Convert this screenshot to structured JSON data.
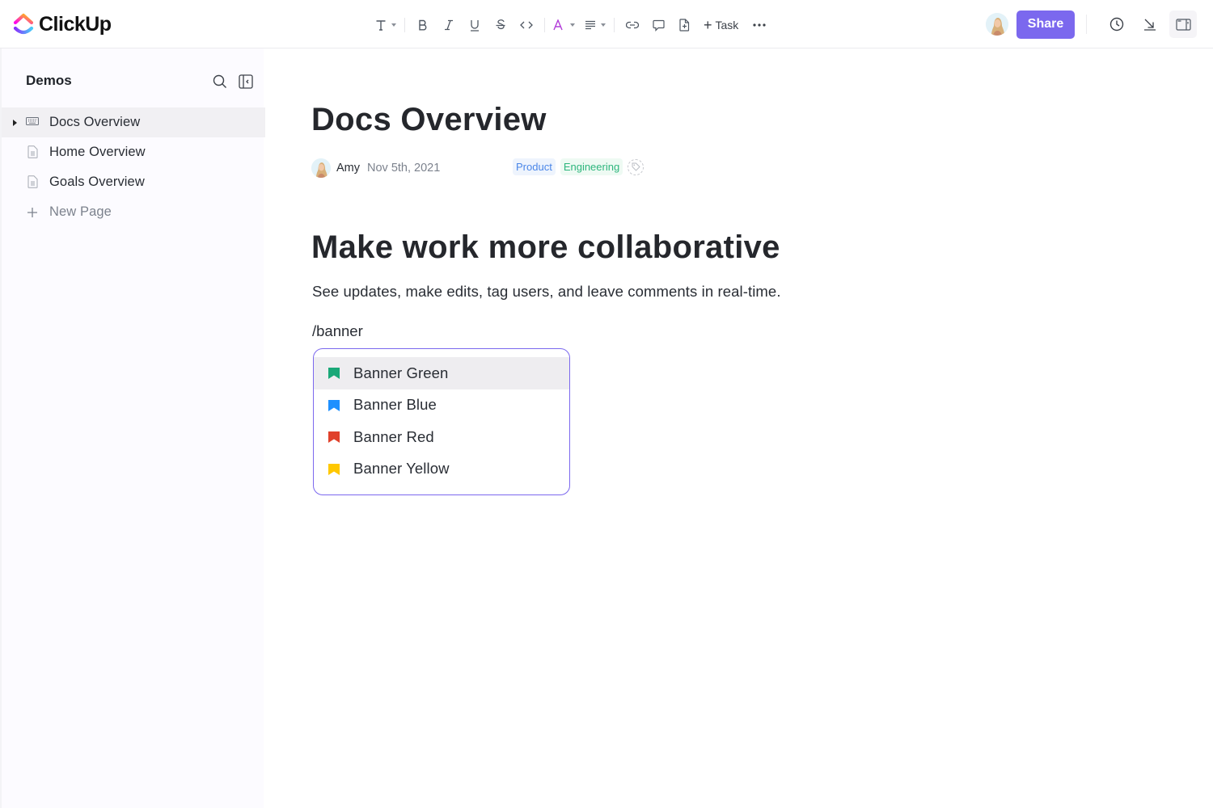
{
  "app": {
    "name": "ClickUp",
    "brand_color": "#7b68ee"
  },
  "toolbar": {
    "items": [
      {
        "name": "text-style",
        "icon": "text-icon",
        "has_dropdown": true
      },
      {
        "name": "bold",
        "icon": "bold-icon"
      },
      {
        "name": "italic",
        "icon": "italic-icon"
      },
      {
        "name": "underline",
        "icon": "underline-icon"
      },
      {
        "name": "strikethrough",
        "icon": "strikethrough-icon"
      },
      {
        "name": "code",
        "icon": "code-icon"
      },
      {
        "name": "text-color",
        "icon": "text-color-icon",
        "has_dropdown": true,
        "color": "#b23cd9"
      },
      {
        "name": "align",
        "icon": "align-icon",
        "has_dropdown": true
      },
      {
        "name": "link",
        "icon": "link-icon"
      },
      {
        "name": "comment",
        "icon": "comment-icon"
      },
      {
        "name": "insert-doc",
        "icon": "file-plus-icon"
      },
      {
        "name": "more",
        "icon": "more-icon"
      }
    ],
    "task_label": "Task",
    "task_prefix": "+"
  },
  "header_right": {
    "share_label": "Share",
    "icons": [
      "history-icon",
      "export-icon",
      "sidebar-panel-icon"
    ]
  },
  "sidebar": {
    "title": "Demos",
    "items": [
      {
        "label": "Docs Overview",
        "icon": "keyboard-icon",
        "active": true,
        "expandable": true
      },
      {
        "label": "Home Overview",
        "icon": "document-icon"
      },
      {
        "label": "Goals Overview",
        "icon": "document-icon"
      },
      {
        "label": "New Page",
        "icon": "plus-icon"
      }
    ]
  },
  "doc": {
    "title": "Docs Overview",
    "author": "Amy",
    "date": "Nov 5th, 2021",
    "tags": [
      {
        "label": "Product",
        "color": "#4a86e8"
      },
      {
        "label": "Engineering",
        "color": "#2eb67d"
      }
    ],
    "heading": "Make work more collaborative",
    "paragraph": "See updates, make edits, tag users, and leave comments in real-time.",
    "slash_command": "/banner"
  },
  "banner_menu": {
    "items": [
      {
        "label": "Banner Green",
        "color": "#1aa878",
        "highlighted": true
      },
      {
        "label": "Banner Blue",
        "color": "#1e90ff"
      },
      {
        "label": "Banner Red",
        "color": "#e0412b"
      },
      {
        "label": "Banner Yellow",
        "color": "#ffc800"
      }
    ]
  }
}
